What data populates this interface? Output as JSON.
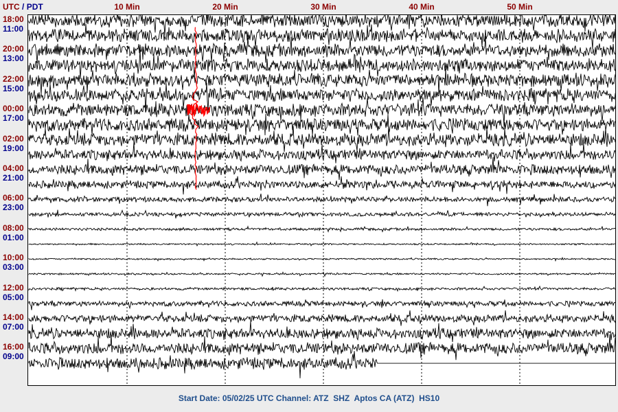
{
  "header": {
    "utc_label": "UTC",
    "separator": " / ",
    "pdt_label": "PDT"
  },
  "chart_data": {
    "type": "line",
    "title": "",
    "x_ticks": [
      {
        "minute": 10,
        "label": "10 Min"
      },
      {
        "minute": 20,
        "label": "20 Min"
      },
      {
        "minute": 30,
        "label": "30 Min"
      },
      {
        "minute": 40,
        "label": "40 Min"
      },
      {
        "minute": 50,
        "label": "50 Min"
      }
    ],
    "xlim_minutes": [
      0,
      60
    ],
    "trace_count": 24,
    "row_labels": [
      {
        "utc": "18:00",
        "local": "11:00"
      },
      {
        "utc": "20:00",
        "local": "13:00"
      },
      {
        "utc": "22:00",
        "local": "15:00"
      },
      {
        "utc": "00:00",
        "local": "17:00"
      },
      {
        "utc": "02:00",
        "local": "19:00"
      },
      {
        "utc": "04:00",
        "local": "21:00"
      },
      {
        "utc": "06:00",
        "local": "23:00"
      },
      {
        "utc": "08:00",
        "local": "01:00"
      },
      {
        "utc": "10:00",
        "local": "03:00"
      },
      {
        "utc": "12:00",
        "local": "05:00"
      },
      {
        "utc": "14:00",
        "local": "07:00"
      },
      {
        "utc": "16:00",
        "local": "09:00"
      }
    ],
    "trace_amplitude_level": [
      5,
      5,
      5,
      5,
      5,
      5,
      5,
      5,
      5,
      4,
      4,
      3,
      2,
      1.5,
      1,
      0.6,
      0.6,
      0.7,
      1,
      2,
      3,
      4,
      4.5,
      4.5
    ],
    "event": {
      "trace_index": 6,
      "minute": 17,
      "color": "#ff0000"
    },
    "last_trace_end_minute": 35.5,
    "trace_color": "#000000",
    "grid": "dotted-vertical"
  },
  "footer": {
    "text": "Start Date: 05/02/25 UTC Channel: ATZ  SHZ  Aptos CA (ATZ)  HS10"
  }
}
